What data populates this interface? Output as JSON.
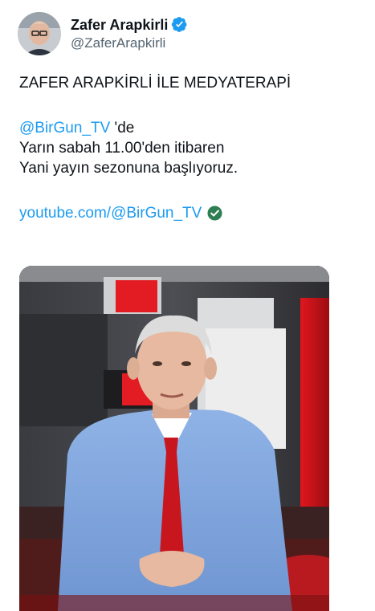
{
  "author": {
    "display_name": "Zafer Arapkirli",
    "handle": "@ZaferArapkirli"
  },
  "post": {
    "line1": "ZAFER ARAPKİRLİ İLE MEDYATERAPİ",
    "mention": "@BirGun_TV",
    "mention_suffix": " 'de",
    "line3": "Yarın sabah 11.00'den itibaren",
    "line4": "Yani yayın sezonuna başlıyoruz.",
    "link": "youtube.com/@BirGun_TV"
  },
  "colors": {
    "accent": "#1d9bf0",
    "verified": "#1d9bf0",
    "link_check": "#2f7d52"
  }
}
